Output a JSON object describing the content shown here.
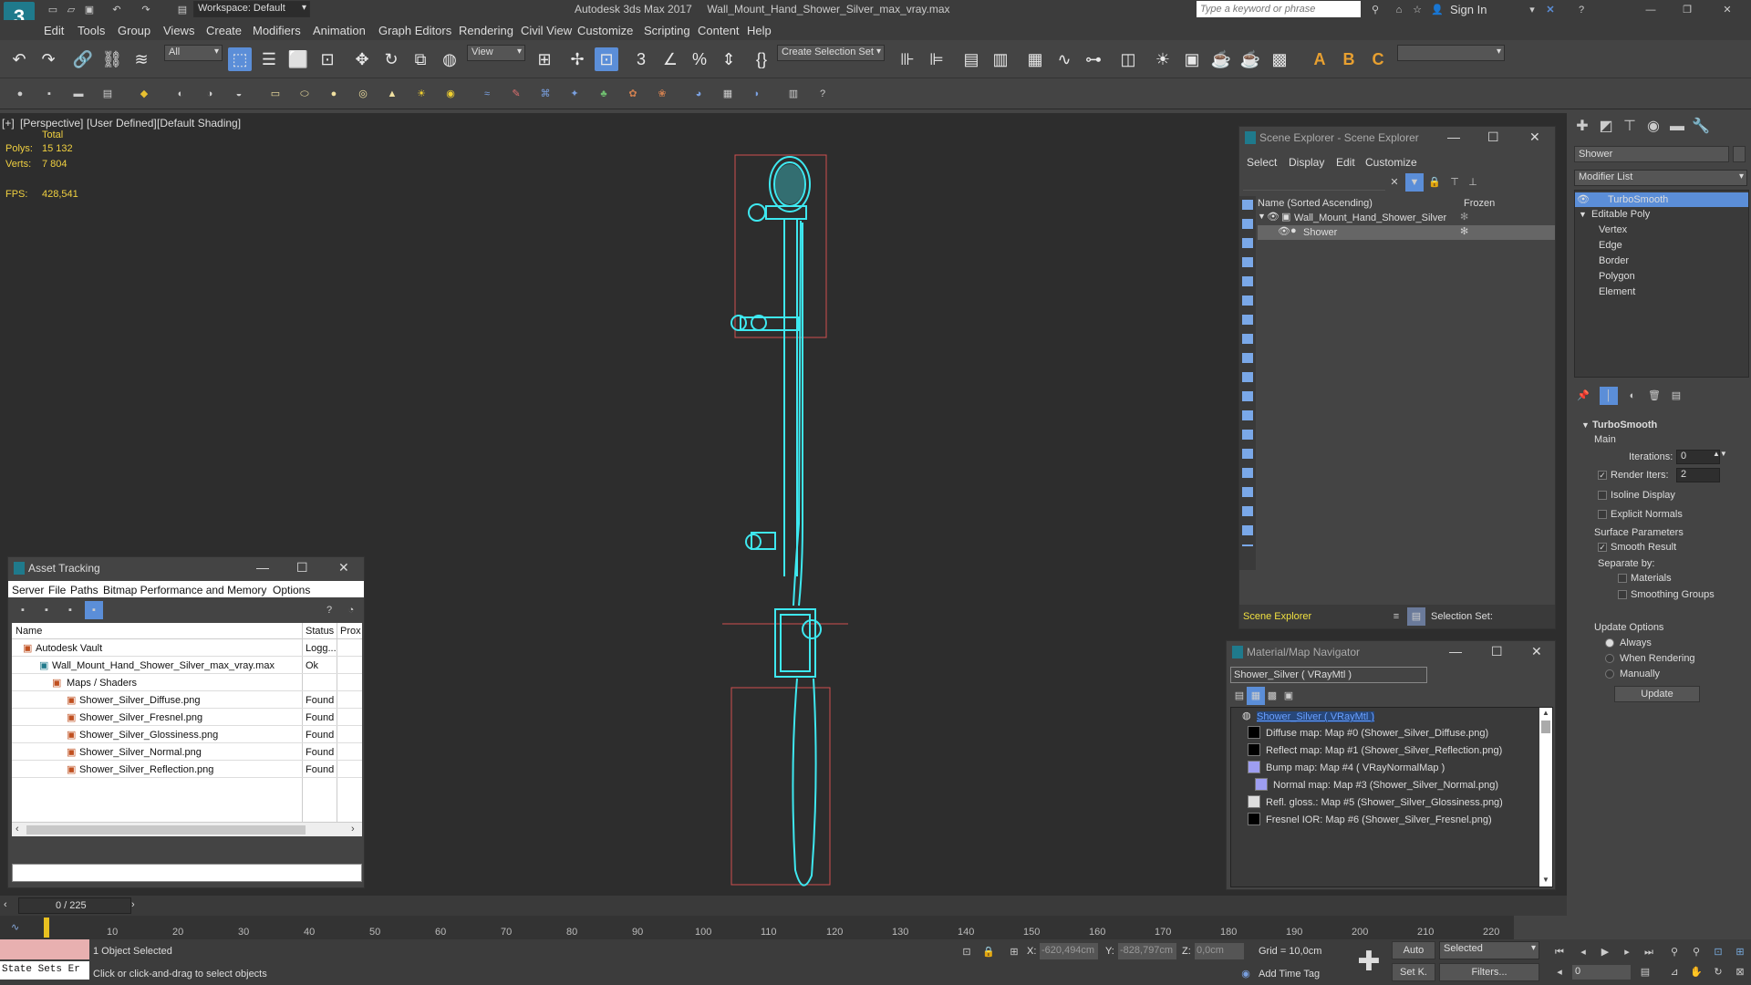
{
  "app": {
    "title": "Autodesk 3ds Max 2017     Wall_Mount_Hand_Shower_Silver_max_vray.max",
    "workspace": "Workspace: Default",
    "search_placeholder": "Type a keyword or phrase",
    "sign_in": "Sign In"
  },
  "menu": [
    "Edit",
    "Tools",
    "Group",
    "Views",
    "Create",
    "Modifiers",
    "Animation",
    "Graph Editors",
    "Rendering",
    "Civil View",
    "Customize",
    "Scripting",
    "Content",
    "Help"
  ],
  "toolbar": {
    "filter_value": "All",
    "view_value": "View",
    "selection_set_value": "Create Selection Set"
  },
  "viewport": {
    "label_plus": "[+]",
    "label_view": "[Perspective]",
    "label_user": "[User Defined]",
    "label_shading": "[Default Shading]",
    "total": "Total",
    "polys_label": "Polys:",
    "polys_value": "15 132",
    "verts_label": "Verts:",
    "verts_value": "7 804",
    "fps_label": "FPS:",
    "fps_value": "428,541"
  },
  "scene_explorer": {
    "title": "Scene Explorer - Scene Explorer",
    "menu": [
      "Select",
      "Display",
      "Edit",
      "Customize"
    ],
    "col_name": "Name (Sorted Ascending)",
    "col_frozen": "Frozen",
    "items": [
      "Wall_Mount_Hand_Shower_Silver",
      "Shower"
    ],
    "footer_name": "Scene Explorer",
    "footer_sel": "Selection Set:"
  },
  "command_panel": {
    "object_name": "Shower",
    "modifier_list": "Modifier List",
    "stack": [
      "TurboSmooth",
      "Editable Poly",
      "Vertex",
      "Edge",
      "Border",
      "Polygon",
      "Element"
    ],
    "rollout_title": "TurboSmooth",
    "main": "Main",
    "iterations_label": "Iterations:",
    "iterations_value": "0",
    "render_iters_label": "Render Iters:",
    "render_iters_value": "2",
    "isoline": "Isoline Display",
    "explicit_normals": "Explicit Normals",
    "surface_params": "Surface Parameters",
    "smooth_result": "Smooth Result",
    "separate_by": "Separate by:",
    "materials": "Materials",
    "smoothing_groups": "Smoothing Groups",
    "update_options": "Update Options",
    "always": "Always",
    "when_rendering": "When Rendering",
    "manually": "Manually",
    "update_btn": "Update"
  },
  "asset_tracking": {
    "title": "Asset Tracking",
    "menu": [
      "Server",
      "File",
      "Paths",
      "Bitmap Performance and Memory",
      "Options"
    ],
    "col_name": "Name",
    "col_status": "Status",
    "col_prox": "Prox",
    "rows": [
      {
        "name": "Autodesk Vault",
        "status": "Logg..."
      },
      {
        "name": "Wall_Mount_Hand_Shower_Silver_max_vray.max",
        "status": "Ok"
      },
      {
        "name": "Maps / Shaders",
        "status": ""
      },
      {
        "name": "Shower_Silver_Diffuse.png",
        "status": "Found"
      },
      {
        "name": "Shower_Silver_Fresnel.png",
        "status": "Found"
      },
      {
        "name": "Shower_Silver_Glossiness.png",
        "status": "Found"
      },
      {
        "name": "Shower_Silver_Normal.png",
        "status": "Found"
      },
      {
        "name": "Shower_Silver_Reflection.png",
        "status": "Found"
      }
    ]
  },
  "material_nav": {
    "title": "Material/Map Navigator",
    "current": "Shower_Silver  ( VRayMtl )",
    "root": "Shower_Silver  ( VRayMtl )",
    "maps": [
      "Diffuse map: Map #0 (Shower_Silver_Diffuse.png)",
      "Reflect map: Map #1 (Shower_Silver_Reflection.png)",
      "Bump map: Map #4  ( VRayNormalMap )",
      "Normal map: Map #3 (Shower_Silver_Normal.png)",
      "Refl. gloss.: Map #5 (Shower_Silver_Glossiness.png)",
      "Fresnel IOR: Map #6 (Shower_Silver_Fresnel.png)"
    ]
  },
  "timeline": {
    "frame": "0 / 225",
    "ticks": [
      "10",
      "20",
      "30",
      "40",
      "50",
      "60",
      "70",
      "80",
      "90",
      "100",
      "110",
      "120",
      "130",
      "140",
      "150",
      "160",
      "170",
      "180",
      "190",
      "200",
      "210",
      "220"
    ]
  },
  "status": {
    "state_sets": "State Sets Er",
    "selected": "1 Object Selected",
    "prompt": "Click or click-and-drag to select objects",
    "x_label": "X:",
    "x_value": "-620,494cm",
    "y_label": "Y:",
    "y_value": "-828,797cm",
    "z_label": "Z:",
    "z_value": "0,0cm",
    "grid": "Grid = 10,0cm",
    "add_time_tag": "Add Time Tag",
    "auto": "Auto",
    "selected_dd": "Selected",
    "setk": "Set K.",
    "filters": "Filters...",
    "frame_value": "0"
  }
}
